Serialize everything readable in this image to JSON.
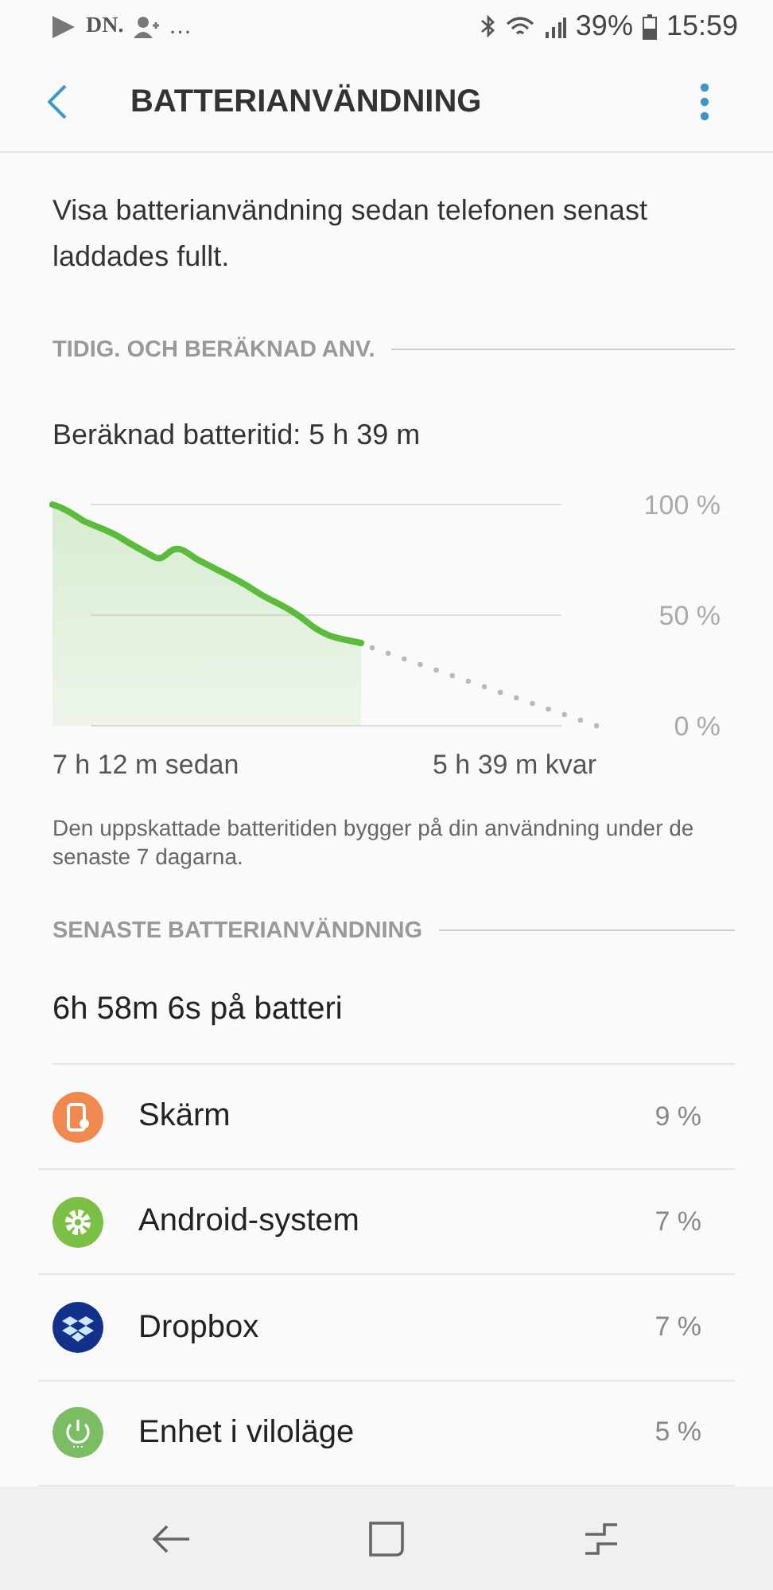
{
  "status_bar": {
    "app_label": "DN.",
    "more": "…",
    "battery": "39%",
    "time": "15:59"
  },
  "app_bar": {
    "title": "BATTERIANVÄNDNING"
  },
  "description": "Visa batterianvändning sedan telefonen senast laddades fullt.",
  "estimate_section": {
    "header": "TIDIG. OCH BERÄKNAD ANV.",
    "estimate": "Beräknad batteritid: 5 h 39 m",
    "graph": {
      "y_labels": [
        "100 %",
        "50 %",
        "0 %"
      ],
      "x_labels": [
        "7 h 12 m sedan",
        "5 h 39 m kvar"
      ]
    },
    "note": "Den uppskattade batteritiden bygger på din användning under de senaste 7 dagarna."
  },
  "usage_section": {
    "header": "SENASTE BATTERIANVÄNDNING",
    "total": "6h 58m 6s på batteri",
    "items": [
      {
        "kind": "screen",
        "name": "Skärm",
        "percent": "9 %",
        "color": "#f0894f"
      },
      {
        "kind": "system",
        "name": "Android-system",
        "percent": "7 %",
        "color": "#7bbf45"
      },
      {
        "kind": "dropbox",
        "name": "Dropbox",
        "percent": "7 %",
        "color": "#12318a"
      },
      {
        "kind": "idle",
        "name": "Enhet i viloläge",
        "percent": "5 %",
        "color": "#7cbd64"
      }
    ]
  }
}
